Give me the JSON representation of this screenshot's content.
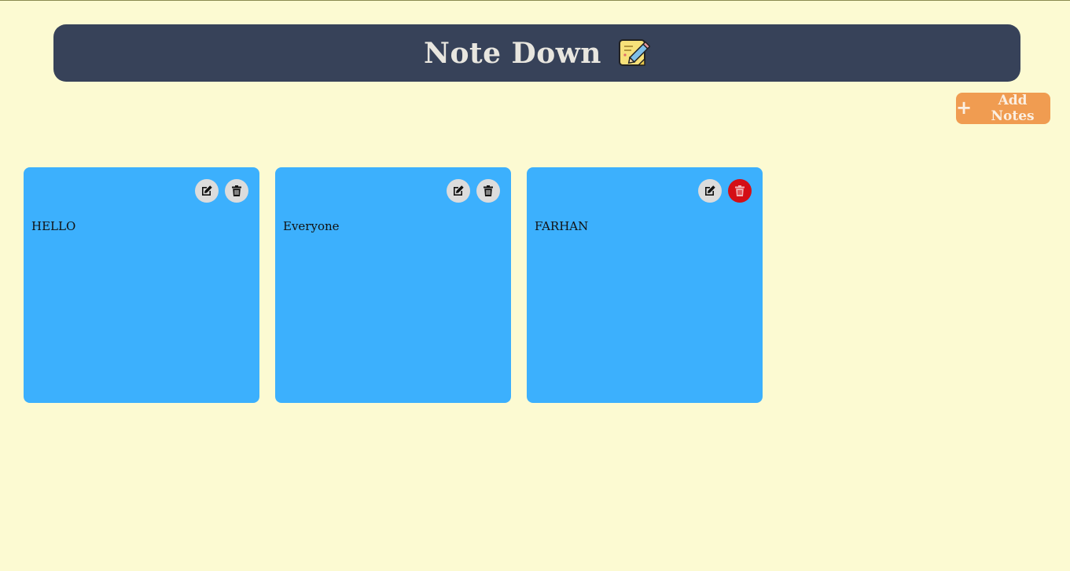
{
  "header": {
    "title": "Note Down",
    "logo_icon": "sticky-note-pencil-icon"
  },
  "toolbar": {
    "add_label": "Add Notes",
    "add_icon": "plus-icon"
  },
  "notes": [
    {
      "text": "HELLO",
      "delete_highlighted": false
    },
    {
      "text": "Everyone",
      "delete_highlighted": false
    },
    {
      "text": "FARHAN",
      "delete_highlighted": true
    }
  ],
  "colors": {
    "background": "#fcfad2",
    "header": "#374259",
    "add_button": "#f09c51",
    "note": "#3cb0fd",
    "delete_active": "#d40f16"
  }
}
